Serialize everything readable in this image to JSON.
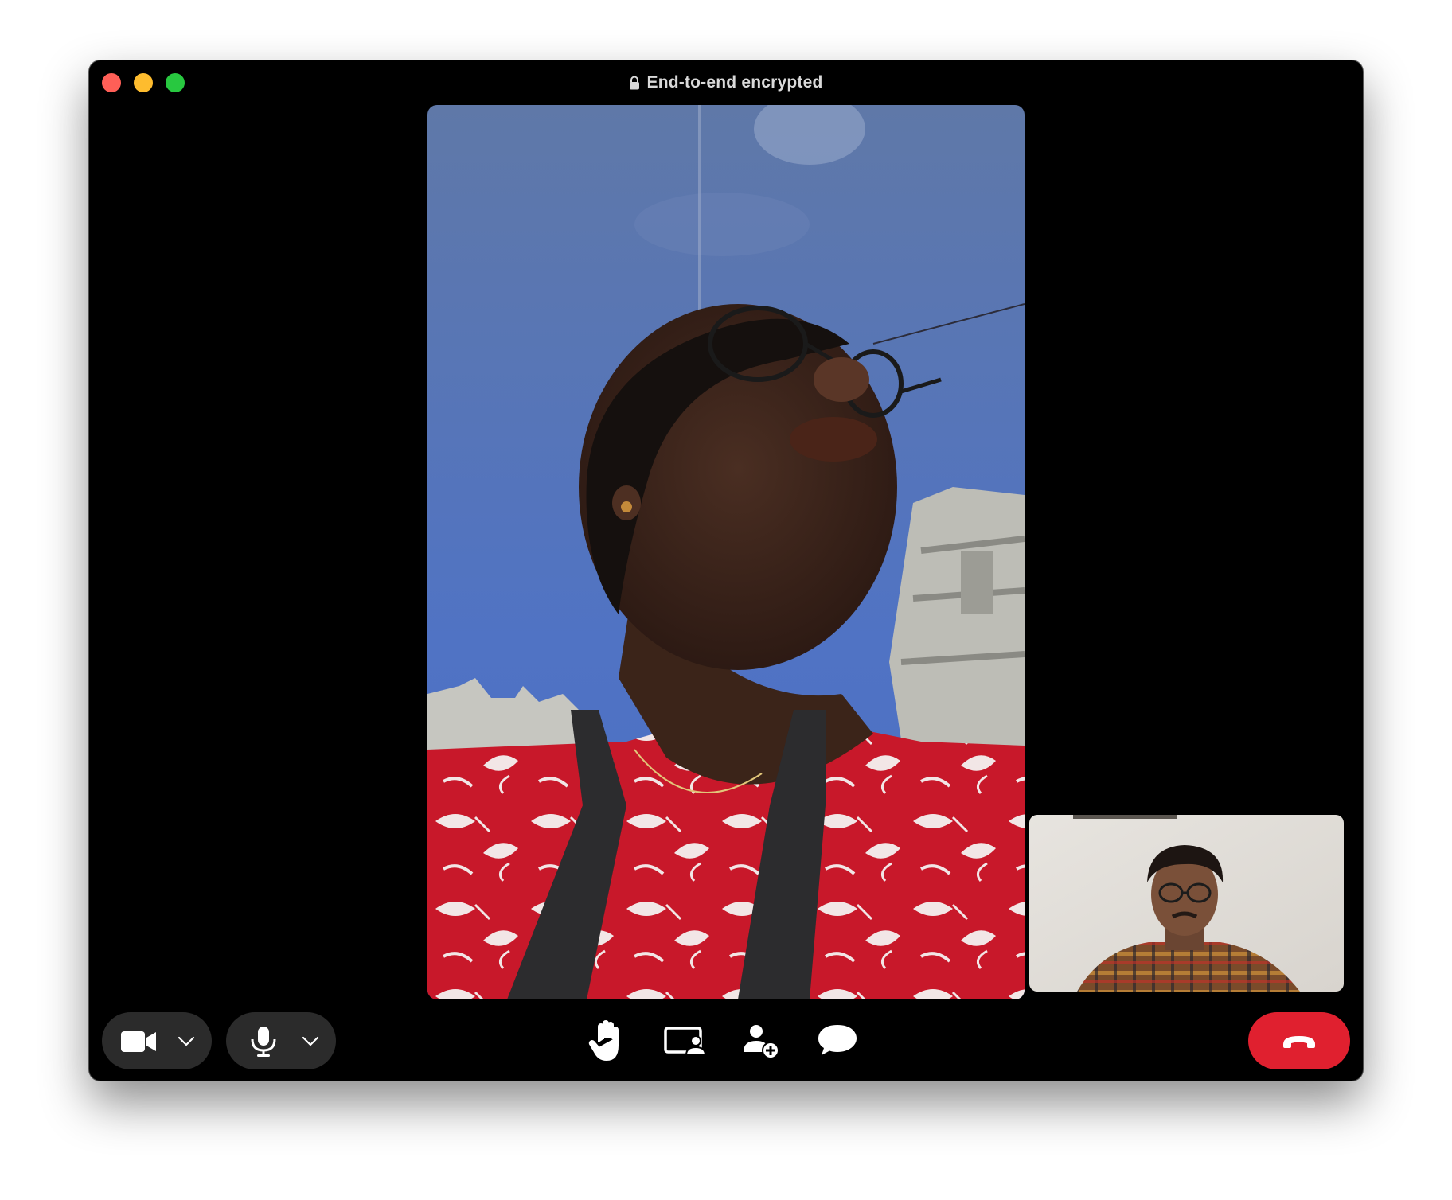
{
  "window": {
    "title": "End-to-end encrypted",
    "traffic_lights": {
      "close_color": "#ff5f57",
      "minimize_color": "#febc2e",
      "maximize_color": "#28c840"
    }
  },
  "remote_video": {
    "icon": "video-feed"
  },
  "self_view": {
    "icon": "self-video-feed"
  },
  "controls": {
    "camera": {
      "icon": "video-camera-icon",
      "menu_icon": "chevron-down-icon"
    },
    "microphone": {
      "icon": "microphone-icon",
      "menu_icon": "chevron-down-icon"
    },
    "raise_hand": {
      "icon": "hand-raise-icon"
    },
    "share_screen": {
      "icon": "screen-share-icon"
    },
    "add_person": {
      "icon": "add-person-icon"
    },
    "chat": {
      "icon": "chat-bubble-icon"
    },
    "end_call": {
      "icon": "hang-up-icon",
      "color": "#e0202f"
    }
  }
}
